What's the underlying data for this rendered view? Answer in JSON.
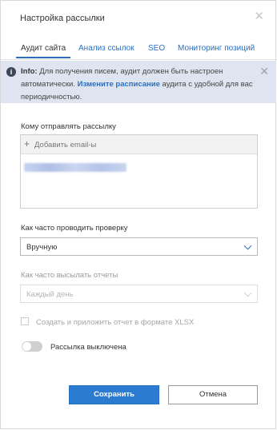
{
  "dialog": {
    "title": "Настройка рассылки",
    "close_icon": "close-icon"
  },
  "tabs": [
    {
      "label": "Аудит сайта",
      "active": true
    },
    {
      "label": "Анализ ссылок",
      "active": false
    },
    {
      "label": "SEO",
      "active": false
    },
    {
      "label": "Мониторинг позиций",
      "active": false
    }
  ],
  "info": {
    "icon": "info-icon",
    "prefix": "Info:",
    "text_before": " Для получения писем, аудит должен быть настроен автоматически. ",
    "link": "Измените расписание",
    "text_after": " аудита с удобной для вас периодичностью."
  },
  "recipients": {
    "label": "Кому отправлять рассылку",
    "add_placeholder": "Добавить email-ы",
    "email_redacted": true
  },
  "check_frequency": {
    "label": "Как часто проводить проверку",
    "value": "Вручную"
  },
  "report_frequency": {
    "label": "Как часто высылать отчеты",
    "value": "Каждый день",
    "disabled": true
  },
  "xlsx": {
    "label": "Создать и приложить отчет в формате XLSX",
    "checked": false
  },
  "mailing_toggle": {
    "label": "Рассылка выключена",
    "on": false
  },
  "buttons": {
    "save": "Сохранить",
    "cancel": "Отмена"
  },
  "colors": {
    "accent": "#2b7bd1",
    "info_bg": "#dfe5f0"
  }
}
